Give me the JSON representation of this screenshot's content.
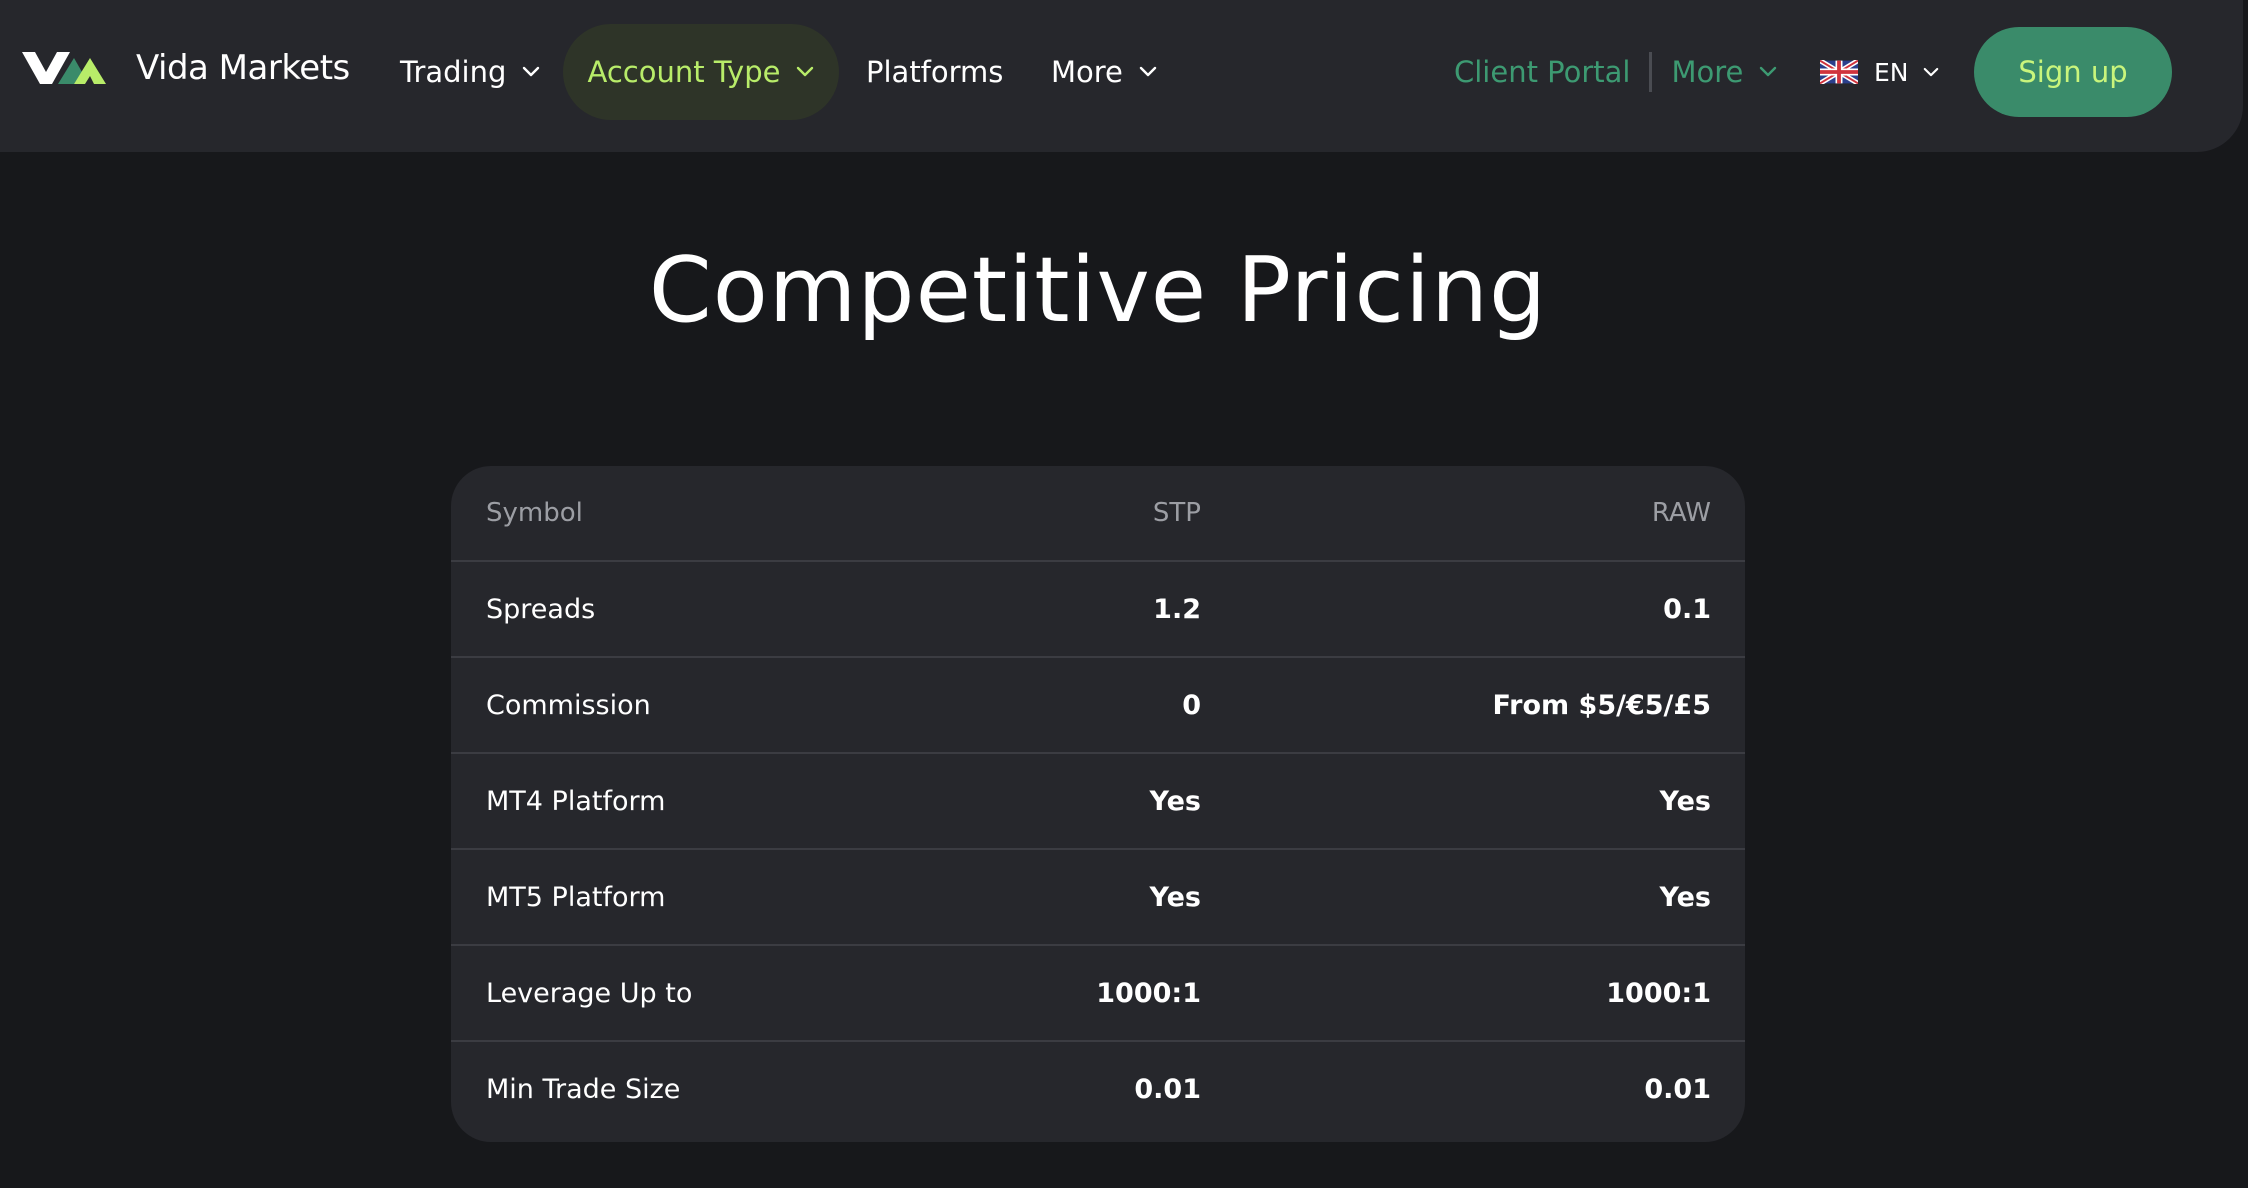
{
  "brand": {
    "name": "Vida Markets"
  },
  "nav": {
    "trading": "Trading",
    "account_type": "Account Type",
    "platforms": "Platforms",
    "more": "More"
  },
  "header_right": {
    "client_portal": "Client Portal",
    "more": "More",
    "language": "EN",
    "signup": "Sign up"
  },
  "colors": {
    "accent_green": "#b8ec69",
    "brand_teal": "#3a8b6a",
    "portal_green": "#3d9a72"
  },
  "icons": [
    "vida-logo-icon",
    "chevron-down-icon",
    "uk-flag-icon"
  ],
  "page": {
    "title": "Competitive Pricing"
  },
  "table": {
    "headers": [
      "Symbol",
      "STP",
      "RAW"
    ],
    "rows": [
      [
        "Spreads",
        "1.2",
        "0.1"
      ],
      [
        "Commission",
        "0",
        "From $5/€5/£5"
      ],
      [
        "MT4 Platform",
        "Yes",
        "Yes"
      ],
      [
        "MT5 Platform",
        "Yes",
        "Yes"
      ],
      [
        "Leverage Up to",
        "1000:1",
        "1000:1"
      ],
      [
        "Min Trade Size",
        "0.01",
        "0.01"
      ]
    ]
  }
}
